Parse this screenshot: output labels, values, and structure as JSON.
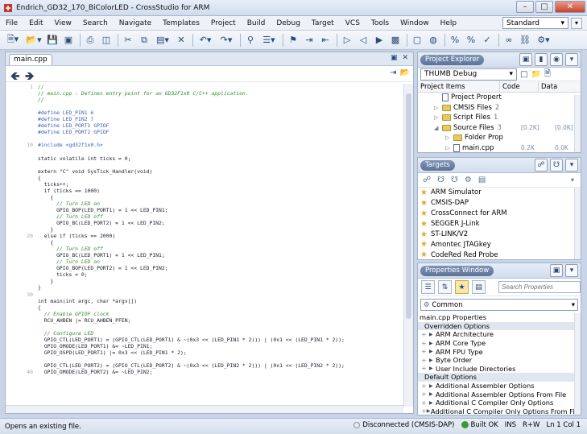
{
  "window": {
    "title": "Endrich_GD32_170_BiColorLED - CrossStudio for ARM"
  },
  "menu": [
    "File",
    "Edit",
    "View",
    "Search",
    "Navigate",
    "Templates",
    "Project",
    "Build",
    "Debug",
    "Target",
    "VCS",
    "Tools",
    "Window",
    "Help"
  ],
  "layout_combo": "Standard",
  "editor": {
    "tab": "main.cpp",
    "code": [
      {
        "t": "//",
        "c": "cm"
      },
      {
        "t": "// main.cpp : Defines entry point for an GD32F1x0 C/C++ application.",
        "c": "cm"
      },
      {
        "t": "//",
        "c": "cm"
      },
      {
        "t": "",
        "c": ""
      },
      {
        "t": "#define LED_PIN1 6",
        "c": "pp"
      },
      {
        "t": "#define LED_PIN2 7",
        "c": "pp"
      },
      {
        "t": "#define LED_PORT1 GPIOF",
        "c": "pp"
      },
      {
        "t": "#define LED_PORT2 GPIOF",
        "c": "pp"
      },
      {
        "t": "",
        "c": ""
      },
      {
        "t": "#include <gd32f1x0.h>",
        "c": "pp"
      },
      {
        "t": "",
        "c": ""
      },
      {
        "t": "static volatile int ticks = 0;",
        "c": "kw"
      },
      {
        "t": "",
        "c": ""
      },
      {
        "t": "extern \"C\" void SysTick_Handler(void)",
        "c": "kw"
      },
      {
        "t": "{",
        "c": "kw"
      },
      {
        "t": "  ticks++;",
        "c": "kw"
      },
      {
        "t": "  if (ticks == 1000)",
        "c": "kw"
      },
      {
        "t": "    {",
        "c": "kw"
      },
      {
        "t": "      // Turn LED on",
        "c": "cm"
      },
      {
        "t": "      GPIO_BOP(LED_PORT1) = 1 << LED_PIN1;",
        "c": "kw"
      },
      {
        "t": "      // Turn LED off",
        "c": "cm"
      },
      {
        "t": "      GPIO_BC(LED_PORT2) = 1 << LED_PIN2;",
        "c": "kw"
      },
      {
        "t": "    }",
        "c": "kw"
      },
      {
        "t": "  else if (ticks == 2000)",
        "c": "kw"
      },
      {
        "t": "    {",
        "c": "kw"
      },
      {
        "t": "      // Turn LED off",
        "c": "cm"
      },
      {
        "t": "      GPIO_BC(LED_PORT1) = 1 << LED_PIN1;",
        "c": "kw"
      },
      {
        "t": "      // Turn LED on",
        "c": "cm"
      },
      {
        "t": "      GPIO_BOP(LED_PORT2) = 1 << LED_PIN2;",
        "c": "kw"
      },
      {
        "t": "      ticks = 0;",
        "c": "kw"
      },
      {
        "t": "    }",
        "c": "kw"
      },
      {
        "t": "}",
        "c": "kw"
      },
      {
        "t": "",
        "c": ""
      },
      {
        "t": "int main(int argc, char *argv[])",
        "c": "kw"
      },
      {
        "t": "{",
        "c": "kw"
      },
      {
        "t": "  // Enable GPIOF clock",
        "c": "cm"
      },
      {
        "t": "  RCU_AHBEN |= RCU_AHBEN_PFEN;",
        "c": "kw"
      },
      {
        "t": "",
        "c": ""
      },
      {
        "t": "  // Configure LED",
        "c": "cm"
      },
      {
        "t": "  GPIO_CTL(LED_PORT1) = (GPIO_CTL(LED_PORT1) & ~(0x3 << (LED_PIN1 * 2))) | (0x1 << (LED_PIN1 * 2));",
        "c": "kw"
      },
      {
        "t": "  GPIO_OMODE(LED_PORT1) &= ~LED_PIN1;",
        "c": "kw"
      },
      {
        "t": "  GPIO_OSPD(LED_PORT1) |= 0x3 << (LED_PIN1 * 2);",
        "c": "kw"
      },
      {
        "t": "",
        "c": ""
      },
      {
        "t": "  GPIO_CTL(LED_PORT2) = (GPIO_CTL(LED_PORT2) & ~(0x3 << (LED_PIN2 * 2))) | (0x1 << (LED_PIN2 * 2));",
        "c": "kw"
      },
      {
        "t": "  GPIO_OMODE(LED_PORT2) &= ~LED_PIN2;",
        "c": "kw"
      }
    ],
    "gutter_marks": {
      "0": "1",
      "9": "10",
      "23": "20",
      "32": "30",
      "44": "40"
    }
  },
  "project_explorer": {
    "title": "Project Explorer",
    "config": "THUMB Debug",
    "columns": [
      "Project Items",
      "Code",
      "Data"
    ],
    "rows": [
      {
        "label": "Project Propert",
        "indent": 1,
        "type": "file",
        "code": "",
        "data": ""
      },
      {
        "label": "CMSIS Files",
        "indent": 1,
        "type": "folder",
        "badge": "2",
        "code": "",
        "data": ""
      },
      {
        "label": "Script Files",
        "indent": 1,
        "type": "folder",
        "badge": "1",
        "code": "",
        "data": ""
      },
      {
        "label": "Source Files",
        "indent": 1,
        "type": "folder-open",
        "badge": "3",
        "code": "[0.2K]",
        "data": "[0.0K]"
      },
      {
        "label": "Folder Prop",
        "indent": 2,
        "type": "folder",
        "code": "",
        "data": ""
      },
      {
        "label": "main.cpp",
        "indent": 2,
        "type": "file",
        "code": "0.2K",
        "data": "0.0K"
      }
    ]
  },
  "targets": {
    "title": "Targets",
    "items": [
      "ARM Simulator",
      "CMSIS-DAP",
      "CrossConnect for ARM",
      "SEGGER J-Link",
      "ST-LINK/V2",
      "Amontec JTAGkey",
      "CodeRed Red Probe"
    ]
  },
  "properties": {
    "title": "Properties Window",
    "search_placeholder": "Search Properties",
    "group": "Common",
    "rows": [
      {
        "label": "main.cpp Properties",
        "kind": "top"
      },
      {
        "label": "Overridden Options",
        "kind": "hdr"
      },
      {
        "label": "ARM Architecture",
        "kind": "item"
      },
      {
        "label": "ARM Core Type",
        "kind": "item"
      },
      {
        "label": "ARM FPU Type",
        "kind": "item"
      },
      {
        "label": "Byte Order",
        "kind": "item"
      },
      {
        "label": "User Include Directories",
        "kind": "item"
      },
      {
        "label": "Default Options",
        "kind": "hdr"
      },
      {
        "label": "Additional Assembler Options",
        "kind": "item"
      },
      {
        "label": "Additional Assembler Options From File",
        "kind": "item"
      },
      {
        "label": "Additional C Compiler Only Options",
        "kind": "item"
      },
      {
        "label": "Additional C Compiler Only Options From File",
        "kind": "item"
      }
    ]
  },
  "status": {
    "message": "Opens an existing file.",
    "connection": "Disconnected (CMSIS-DAP)",
    "build": "Built OK",
    "ins": "INS",
    "rw": "R+W",
    "position": "Ln 1 Col 1"
  }
}
